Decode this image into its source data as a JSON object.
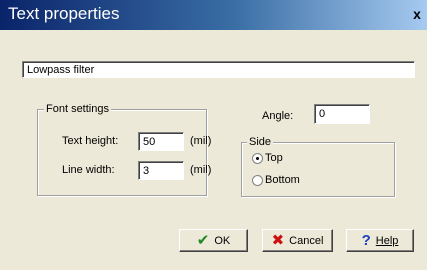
{
  "window": {
    "title": "Text properties",
    "close_label": "x"
  },
  "text_field": {
    "value": "Lowpass filter"
  },
  "font_settings": {
    "legend": "Font settings",
    "text_height_label": "Text height:",
    "text_height_value": "50",
    "text_height_unit": "(mil)",
    "line_width_label": "Line width:",
    "line_width_value": "3",
    "line_width_unit": "(mil)"
  },
  "angle": {
    "label": "Angle:",
    "value": "0"
  },
  "side": {
    "legend": "Side",
    "options": [
      {
        "label": "Top",
        "selected": true
      },
      {
        "label": "Bottom",
        "selected": false
      }
    ]
  },
  "buttons": {
    "ok": {
      "label": "OK",
      "icon": "check-icon",
      "color": "#1f8a1f"
    },
    "cancel": {
      "label": "Cancel",
      "icon": "x-icon",
      "color": "#cc1111"
    },
    "help": {
      "label": "Help",
      "icon": "question-icon",
      "color": "#1a3fbf"
    }
  },
  "colors": {
    "title_start": "#0a246a",
    "title_end": "#a6caf0",
    "dialog_bg": "#ece9d8"
  }
}
